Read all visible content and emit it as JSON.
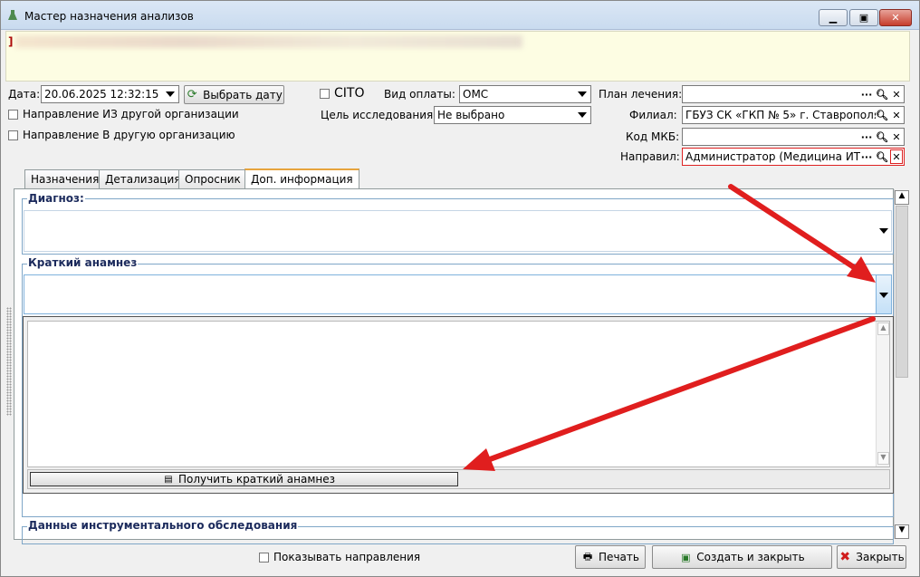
{
  "window": {
    "title": "Мастер назначения анализов",
    "banner_text": "]"
  },
  "header": {
    "date_label": "Дата:",
    "date_value": "20.06.2025 12:32:15",
    "pick_date_label": "Выбрать дату",
    "cito_label": "CITO",
    "payment_label": "Вид оплаты:",
    "payment_value": "ОМС",
    "purpose_label": "Цель исследования:",
    "purpose_value": "Не выбрано",
    "from_org_label": "Направление ИЗ другой организации",
    "to_org_label": "Направление В другую организацию",
    "plan_label": "План лечения:",
    "plan_value": "",
    "branch_label": "Филиал:",
    "branch_value": "ГБУЗ СК «ГКП № 5» г. Ставрополя",
    "icd_label": "Код МКБ:",
    "icd_value": "",
    "sender_label": "Направил:",
    "sender_value": "Администратор (Медицина ИТ)",
    "ellipsis": "···"
  },
  "tabs": [
    {
      "label": "Назначения"
    },
    {
      "label": "Детализация"
    },
    {
      "label": "Опросник"
    },
    {
      "label": "Доп. информация"
    }
  ],
  "main": {
    "diagnosis_title": "Диагноз:",
    "anamnesis_title": "Краткий анамнез",
    "get_anamnesis_label": "Получить краткий анамнез",
    "instrumental_title": "Данные инструментального обследования"
  },
  "footer": {
    "show_directions_label": "Показывать направления",
    "print_label": "Печать",
    "create_close_label": "Создать и закрыть",
    "close_label": "Закрыть"
  },
  "colors": {
    "arrow": "#e01e1e",
    "group_title": "#1b2a5c",
    "banner_bg": "#fdfde3"
  }
}
